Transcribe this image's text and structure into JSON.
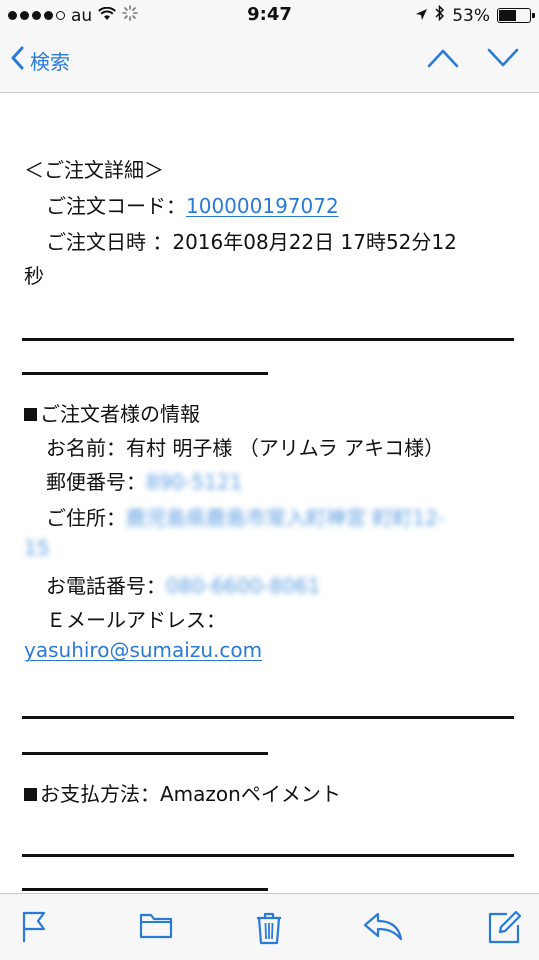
{
  "status_bar": {
    "carrier": "au",
    "time": "9:47",
    "battery": "53%"
  },
  "nav": {
    "back_label": "検索"
  },
  "email": {
    "section_header": "＜ご注文詳細＞",
    "order_code_label": "ご注文コード：",
    "order_code_value": "100000197072",
    "order_datetime_label": "ご注文日時 ：",
    "order_datetime_value": "2016年08月22日 17時52分12",
    "order_datetime_wrap": "秒",
    "customer_section": "ご注文者様の情報",
    "name_label": "お名前：",
    "name_value": "有村 明子様 （アリムラ アキコ様）",
    "postal_label": "郵便番号：",
    "postal_value": "890-5121",
    "address_label": "ご住所：",
    "address_value": "鹿児島県鹿島市常入町神宮 町町12-",
    "address_wrap": "15",
    "phone_label": "お電話番号：",
    "phone_value": "080-6600-8061",
    "email_label": "Ｅメールアドレス：",
    "email_value": "yasuhiro@sumaizu.com",
    "payment_label": "お支払方法：",
    "payment_value": "Amazonペイメント"
  },
  "colors": {
    "link": "#2a7ad8",
    "bar_bg": "#f7f7f7"
  }
}
